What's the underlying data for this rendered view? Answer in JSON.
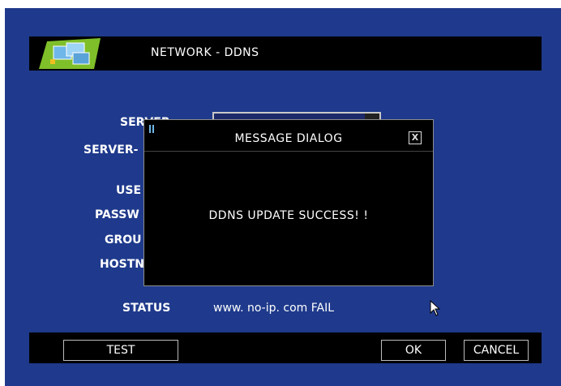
{
  "header": {
    "title": "NETWORK - DDNS",
    "logo_icon": "network-monitor-icon"
  },
  "form": {
    "server_label": "SERVER",
    "server_type_label": "SERVER-",
    "user_label": "USE",
    "password_label": "PASSW",
    "group_label": "GROU",
    "hostname_label": "HOSTN",
    "status_label": "STATUS",
    "status_value": "www. no-ip. com FAIL"
  },
  "dialog": {
    "title": "MESSAGE DIALOG",
    "message": "DDNS UPDATE SUCCESS! !",
    "close_glyph": "X"
  },
  "footer": {
    "test_label": "TEST",
    "ok_label": "OK",
    "cancel_label": "CANCEL"
  },
  "colors": {
    "background": "#1f3a8c",
    "bar": "#000000",
    "text": "#ffffff"
  }
}
